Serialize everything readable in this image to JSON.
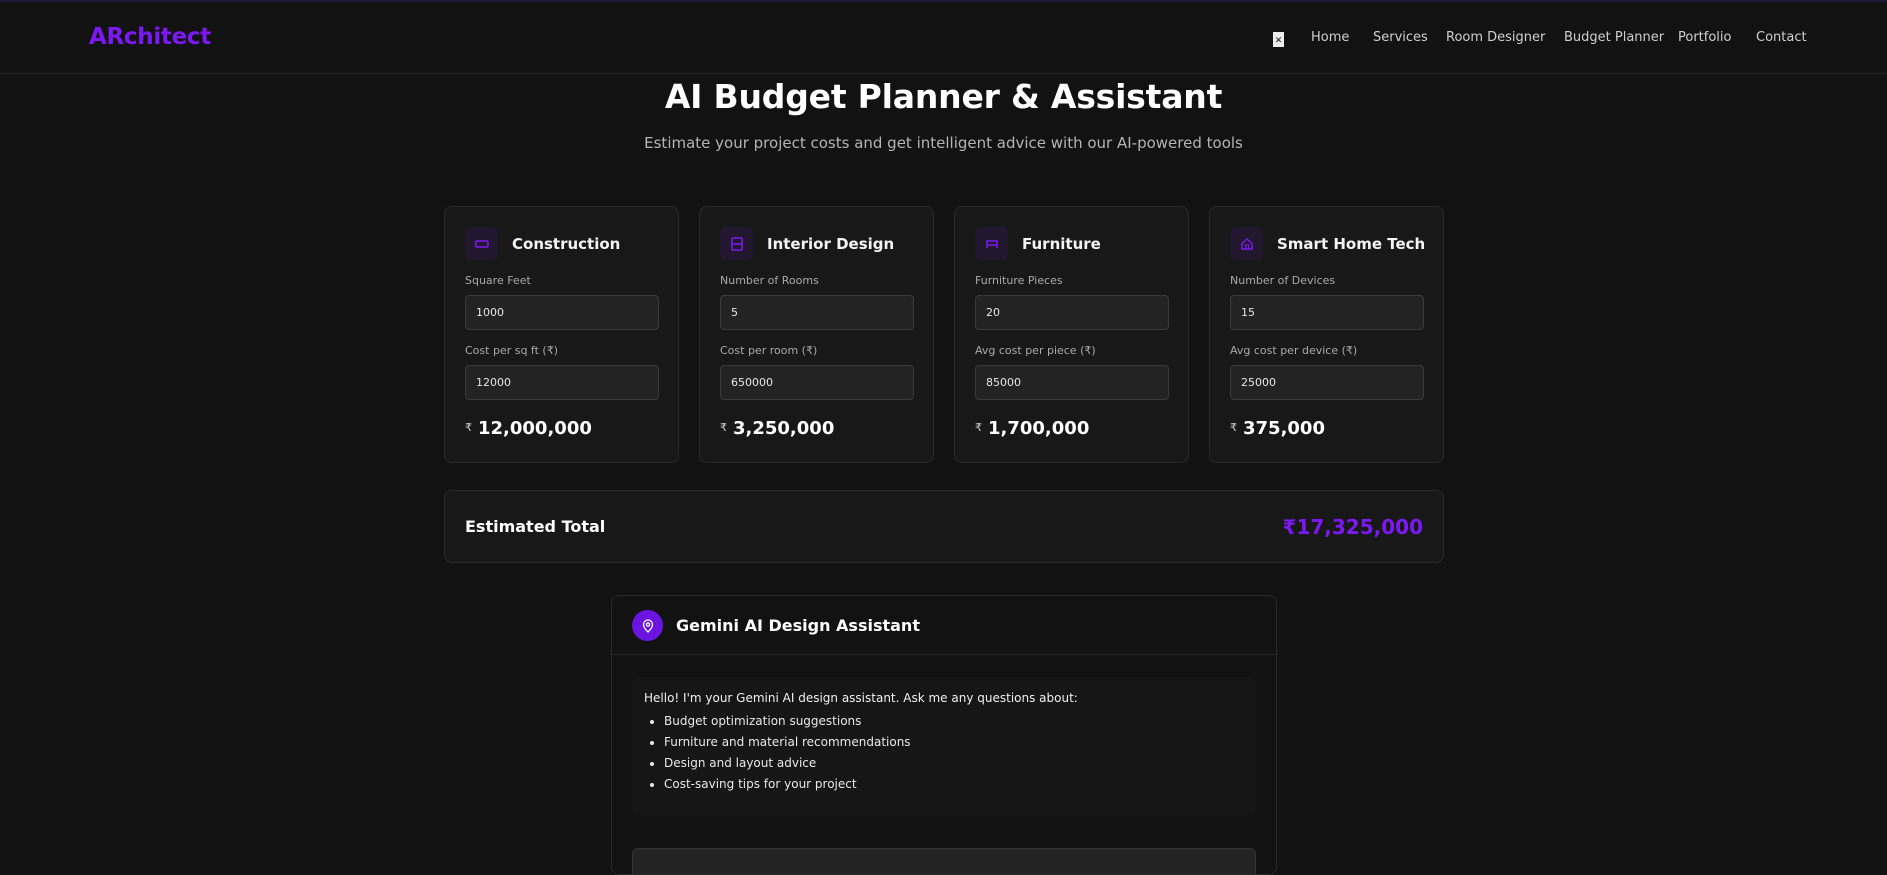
{
  "header": {
    "logo": "ARchitect",
    "menu_glyph": "✕",
    "nav": [
      {
        "label": "Home"
      },
      {
        "label": "Services"
      },
      {
        "label": "Room Designer"
      },
      {
        "label": "Budget Planner"
      },
      {
        "label": "Portfolio"
      },
      {
        "label": "Contact"
      }
    ]
  },
  "page": {
    "title": "AI Budget Planner & Assistant",
    "subtitle": "Estimate your project costs and get intelligent advice with our AI-powered tools"
  },
  "cards": [
    {
      "title": "Construction",
      "icon": "rectangle-icon",
      "field1_label": "Square Feet",
      "field1_value": "1000",
      "field2_label": "Cost per sq ft (₹)",
      "field2_value": "12000",
      "currency": "₹",
      "total": "12,000,000"
    },
    {
      "title": "Interior Design",
      "icon": "layout-icon",
      "field1_label": "Number of Rooms",
      "field1_value": "5",
      "field2_label": "Cost per room (₹)",
      "field2_value": "650000",
      "currency": "₹",
      "total": "3,250,000"
    },
    {
      "title": "Furniture",
      "icon": "bed-icon",
      "field1_label": "Furniture Pieces",
      "field1_value": "20",
      "field2_label": "Avg cost per piece (₹)",
      "field2_value": "85000",
      "currency": "₹",
      "total": "1,700,000"
    },
    {
      "title": "Smart Home Tech",
      "icon": "home-icon",
      "field1_label": "Number of Devices",
      "field1_value": "15",
      "field2_label": "Avg cost per device (₹)",
      "field2_value": "25000",
      "currency": "₹",
      "total": "375,000"
    }
  ],
  "summary": {
    "label": "Estimated Total",
    "value": "₹17,325,000"
  },
  "assistant": {
    "title": "Gemini AI Design Assistant",
    "intro": "Hello! I'm your Gemini AI design assistant. Ask me any questions about:",
    "topics": [
      "Budget optimization suggestions",
      "Furniture and material recommendations",
      "Design and layout advice",
      "Cost-saving tips for your project"
    ]
  },
  "colors": {
    "accent": "#7c18f2",
    "background": "#121212",
    "card": "#181818"
  }
}
